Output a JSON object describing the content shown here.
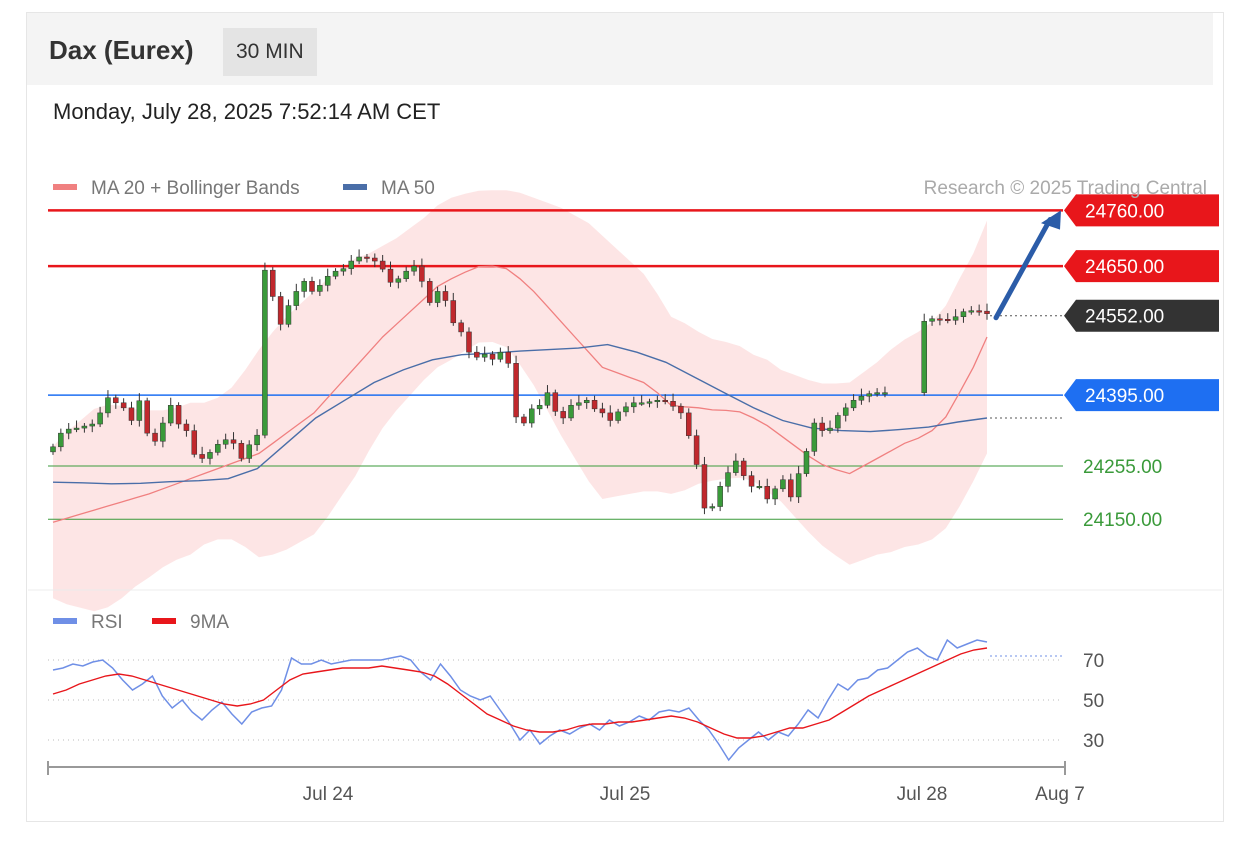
{
  "header": {
    "title": "Dax (Eurex)",
    "timeframe": "30 MIN"
  },
  "datetime": "Monday, July 28, 2025 7:52:14 AM CET",
  "legend": {
    "ma20": "MA 20 + Bollinger Bands",
    "ma50": "MA 50",
    "source": "Research © 2025 Trading Central",
    "rsi": "RSI",
    "rsi_ma": "9MA"
  },
  "colors": {
    "resistance": "#e8161b",
    "support": "#3a9a3a",
    "pivot": "#1e6ff2",
    "current": "#333333",
    "ma20": "#f08080",
    "ma50": "#4a6ea8",
    "band": "#fde0e0",
    "rsi": "#6f8fe6",
    "rsi_ma": "#e8161b",
    "arrow": "#2b5ca8"
  },
  "chart_data": [
    {
      "type": "candlestick",
      "title": "",
      "ylim": [
        24020,
        24830
      ],
      "x_ticks": [
        "Jul 24",
        "Jul 25",
        "Jul 28",
        "Aug 7"
      ],
      "levels": [
        {
          "value": 24760.0,
          "label": "24760.00",
          "kind": "resistance"
        },
        {
          "value": 24650.0,
          "label": "24650.00",
          "kind": "resistance"
        },
        {
          "value": 24552.0,
          "label": "24552.00",
          "kind": "current"
        },
        {
          "value": 24395.0,
          "label": "24395.00",
          "kind": "pivot"
        },
        {
          "value": 24255.0,
          "label": "24255.00",
          "kind": "support"
        },
        {
          "value": 24150.0,
          "label": "24150.00",
          "kind": "support"
        }
      ],
      "closes": [
        24293,
        24320,
        24328,
        24330,
        24334,
        24338,
        24360,
        24390,
        24380,
        24370,
        24345,
        24384,
        24320,
        24304,
        24340,
        24375,
        24338,
        24325,
        24278,
        24270,
        24282,
        24298,
        24307,
        24300,
        24270,
        24297,
        24316,
        24642,
        24590,
        24535,
        24572,
        24600,
        24620,
        24600,
        24612,
        24630,
        24640,
        24645,
        24660,
        24668,
        24666,
        24660,
        24644,
        24618,
        24625,
        24640,
        24650,
        24620,
        24578,
        24600,
        24582,
        24538,
        24520,
        24480,
        24470,
        24476,
        24466,
        24480,
        24458,
        24352,
        24340,
        24368,
        24375,
        24400,
        24363,
        24350,
        24375,
        24380,
        24385,
        24368,
        24360,
        24345,
        24362,
        24372,
        24380,
        24380,
        24382,
        24385,
        24383,
        24373,
        24360,
        24315,
        24258,
        24172,
        24175,
        24215,
        24242,
        24265,
        24236,
        24215,
        24215,
        24190,
        24210,
        24228,
        24194,
        24240,
        24284,
        24340,
        24325,
        24330,
        24355,
        24370,
        24385,
        24393,
        24398,
        24400,
        24400,
        null,
        null,
        null,
        null,
        24541,
        24546,
        24545,
        24543,
        24550,
        24560,
        24562,
        24561,
        24556
      ],
      "ma20": [
        24144,
        24152,
        24160,
        24168,
        24176,
        24184,
        24192,
        24200,
        24210,
        24220,
        24230,
        24240,
        24250,
        24260,
        24270,
        24280,
        24300,
        24320,
        24340,
        24360,
        24390,
        24420,
        24450,
        24480,
        24510,
        24535,
        24560,
        24585,
        24610,
        24625,
        24638,
        24649,
        24650,
        24645,
        24625,
        24600,
        24570,
        24540,
        24510,
        24480,
        24450,
        24440,
        24430,
        24420,
        24400,
        24375,
        24372,
        24370,
        24366,
        24365,
        24362,
        24350,
        24335,
        24315,
        24295,
        24275,
        24258,
        24248,
        24240,
        24255,
        24270,
        24285,
        24300,
        24310,
        24325,
        24352,
        24400,
        24450,
        24510
      ],
      "ma50": [
        24223,
        24222,
        24220,
        24221,
        24224,
        24226,
        24230,
        24250,
        24300,
        24350,
        24385,
        24420,
        24445,
        24465,
        24475,
        24478,
        24482,
        24485,
        24488,
        24495,
        24480,
        24460,
        24430,
        24400,
        24370,
        24345,
        24330,
        24325,
        24323,
        24327,
        24332,
        24342,
        24350
      ]
    },
    {
      "type": "line",
      "title": "",
      "ylim": [
        15,
        85
      ],
      "y_ticks": [
        70,
        50,
        30
      ],
      "rsi": [
        65,
        66,
        68,
        67,
        69,
        70,
        66,
        60,
        55,
        58,
        62,
        52,
        46,
        50,
        44,
        40,
        45,
        49,
        43,
        38,
        44,
        46,
        47,
        55,
        71,
        68,
        68,
        70,
        68,
        69,
        70,
        70,
        70,
        70,
        71,
        72,
        70,
        64,
        60,
        68,
        62,
        55,
        52,
        50,
        52,
        45,
        38,
        30,
        35,
        28,
        32,
        35,
        33,
        36,
        38,
        35,
        40,
        37,
        39,
        42,
        40,
        44,
        45,
        44,
        46,
        40,
        35,
        28,
        20,
        26,
        30,
        34,
        30,
        34,
        32,
        38,
        45,
        41,
        50,
        58,
        55,
        60,
        61,
        65,
        66,
        70,
        74,
        76,
        72,
        70,
        80,
        76,
        78,
        80,
        79
      ],
      "rsi_ma": [
        53,
        55,
        58,
        60,
        62,
        63,
        62,
        60,
        58,
        56,
        54,
        52,
        50,
        48,
        47,
        48,
        50,
        55,
        60,
        63,
        64,
        65,
        66,
        66,
        66,
        67,
        66,
        65,
        64,
        62,
        58,
        53,
        48,
        43,
        40,
        37,
        35,
        34,
        34,
        35,
        37,
        38,
        38,
        39,
        39,
        40,
        41,
        42,
        41,
        39,
        36,
        33,
        31,
        31,
        32,
        34,
        36,
        36,
        38,
        40,
        44,
        48,
        52,
        55,
        58,
        61,
        64,
        67,
        70,
        73,
        75,
        76
      ]
    }
  ]
}
